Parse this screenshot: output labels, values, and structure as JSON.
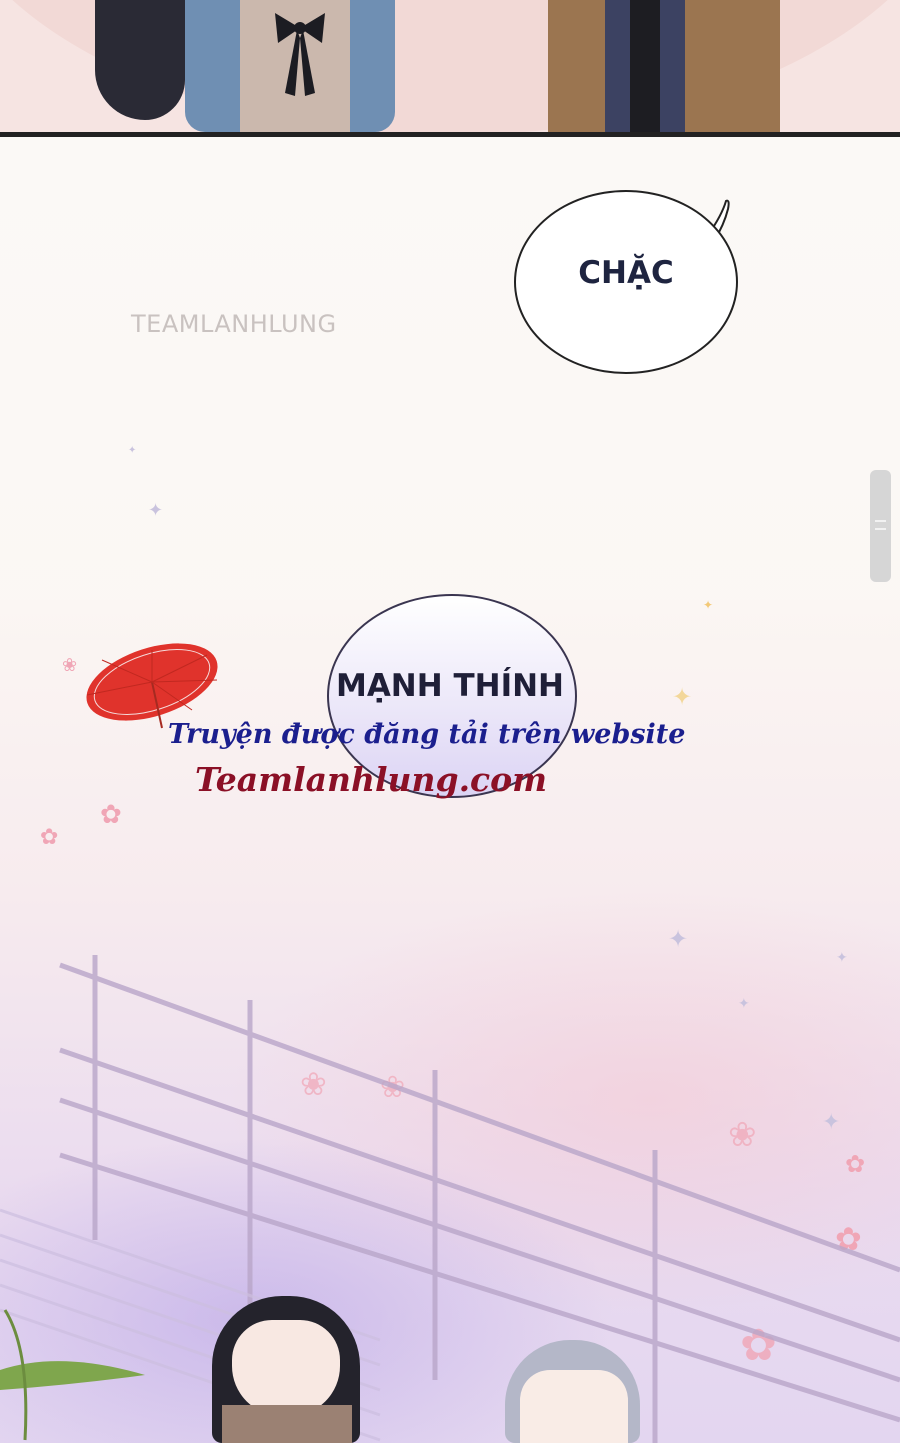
{
  "panel_top": {
    "description_hidden": ""
  },
  "watermark": {
    "text": "TEAMLANHLUNG"
  },
  "bubble_sfx": {
    "text": "CHẶC"
  },
  "name_bubble": {
    "text": "MẠNH THÍNH"
  },
  "site_notice": {
    "line1": "Truyện được đăng tải trên website",
    "line2": "Teamlanhlung.com"
  },
  "colors": {
    "sfx_text": "#1e2440",
    "site_line1": "#1b1f8e",
    "site_line2": "#8b1026",
    "umbrella": "#e0332c"
  },
  "icons": {
    "scroll": "scroll-handle-icon"
  }
}
